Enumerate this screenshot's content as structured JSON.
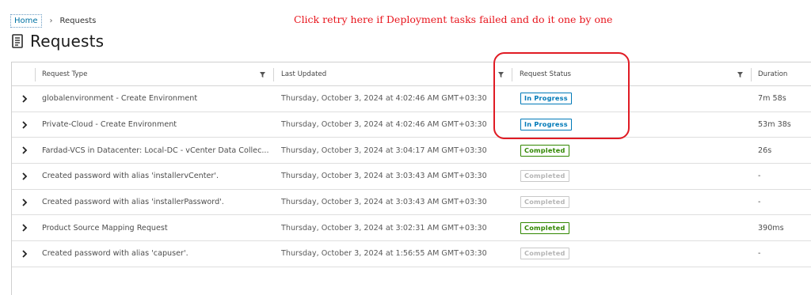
{
  "breadcrumb": {
    "home": "Home",
    "separator": "›",
    "current": "Requests"
  },
  "annotation": "Click retry here if Deployment tasks failed and do it one by one",
  "page": {
    "title": "Requests",
    "icon": "document-list-icon"
  },
  "columns": {
    "type": "Request Type",
    "updated": "Last Updated",
    "status": "Request Status",
    "duration": "Duration"
  },
  "rows": [
    {
      "type": "globalenvironment - Create Environment",
      "updated": "Thursday, October 3, 2024 at 4:02:46 AM GMT+03:30",
      "status": "In Progress",
      "duration": "7m 58s"
    },
    {
      "type": "Private-Cloud - Create Environment",
      "updated": "Thursday, October 3, 2024 at 4:02:46 AM GMT+03:30",
      "status": "In Progress",
      "duration": "53m 38s"
    },
    {
      "type": "Fardad-VCS in Datacenter: Local-DC - vCenter Data Collec...",
      "updated": "Thursday, October 3, 2024 at 3:04:17 AM GMT+03:30",
      "status": "Completed",
      "duration": "26s"
    },
    {
      "type": "Created password with alias 'installervCenter'.",
      "updated": "Thursday, October 3, 2024 at 3:03:43 AM GMT+03:30",
      "status": "Completed",
      "duration": "-"
    },
    {
      "type": "Created password with alias 'installerPassword'.",
      "updated": "Thursday, October 3, 2024 at 3:03:43 AM GMT+03:30",
      "status": "Completed",
      "duration": "-"
    },
    {
      "type": "Product Source Mapping Request",
      "updated": "Thursday, October 3, 2024 at 3:02:31 AM GMT+03:30",
      "status": "Completed",
      "duration": "390ms"
    },
    {
      "type": "Created password with alias 'capuser'.",
      "updated": "Thursday, October 3, 2024 at 1:56:55 AM GMT+03:30",
      "status": "Completed",
      "duration": "-"
    }
  ],
  "colors": {
    "in_progress": "#0079b8",
    "completed": "#318700",
    "completed_faded": "#b5b5b5",
    "annotation": "#e8141c"
  }
}
